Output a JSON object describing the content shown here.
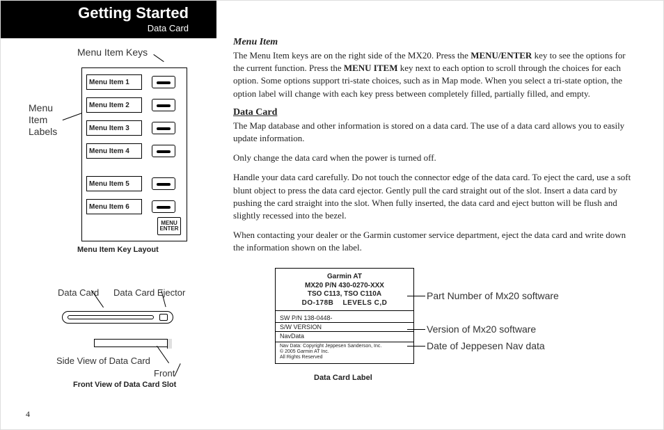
{
  "header": {
    "title": "Getting Started",
    "subtitle": "Data Card"
  },
  "page_number": "4",
  "fig1": {
    "label_top": "Menu Item Keys",
    "label_left": "Menu Item Labels",
    "items": [
      "Menu Item 1",
      "Menu Item 2",
      "Menu Item 3",
      "Menu Item 4",
      "Menu Item 5",
      "Menu Item 6"
    ],
    "menu_enter_top": "MENU",
    "menu_enter_bottom": "ENTER",
    "caption": "Menu Item Key Layout"
  },
  "fig2": {
    "label_card": "Data Card",
    "label_ejector": "Data Card Ejector",
    "label_side": "Side View of Data Card",
    "label_front": "Front",
    "caption": "Front View of Data Card Slot"
  },
  "body": {
    "menu_item_heading": "Menu Item",
    "menu_item_para": "The Menu Item keys are on the right side of the MX20. Press the MENU/ENTER key to see the options for the current function. Press the MENU ITEM key next to each option to scroll through the choices for each option. Some options support tri-state choices, such as in Map mode. When you select a tri-state option, the option label will change with each key press between completely filled, partially filled, and empty.",
    "data_card_heading": "Data Card",
    "dc_p1": "The Map database and other information is stored on a data card. The use of a data card allows you to easily update information.",
    "dc_p2": "Only change the data card when the power is turned off.",
    "dc_p3": "Handle your data card carefully. Do not touch the connector edge of the data card. To eject the card, use a soft blunt object to press the data card ejector. Gently pull the card straight out of the slot. Insert a data card by pushing the card straight into the slot. When fully inserted, the data card and eject button will be flush and slightly recessed into the bezel.",
    "dc_p4": "When contacting your dealer or the Garmin customer service department, eject the data card and write down the information shown on the label."
  },
  "fig3": {
    "brand": "Garmin AT",
    "pn": "MX20 P/N 430-0270-XXX",
    "tso": "TSO C113, TSO C110A",
    "do": "DO-178B    LEVELS C,D",
    "row1": "SW P/N 138-0448-",
    "row2": "S/W VERSION",
    "row3": "NavData",
    "foot1": "Nav Data: Copyright Jeppesen Sanderson, Inc.",
    "foot2": "© 2005 Garmin AT Inc.",
    "foot3": "All Rights Reserved",
    "caption": "Data Card Label",
    "callout1": "Part Number of Mx20 software",
    "callout2": "Version of Mx20 software",
    "callout3": "Date of Jeppesen Nav data"
  }
}
